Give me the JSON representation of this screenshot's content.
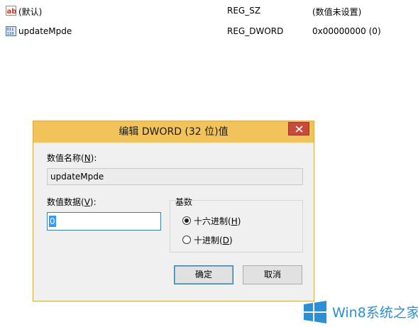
{
  "registry": {
    "rows": [
      {
        "icon": "string-value-icon",
        "name": "(默认)",
        "type": "REG_SZ",
        "data": "(数值未设置)"
      },
      {
        "icon": "dword-value-icon",
        "name": "updateMpde",
        "type": "REG_DWORD",
        "data": "0x00000000 (0)"
      }
    ]
  },
  "dialog": {
    "title": "编辑 DWORD (32 位)值",
    "name_label_pre": "数值名称(",
    "name_label_key": "N",
    "name_label_post": "):",
    "name_value": "updateMpde",
    "data_label_pre": "数值数据(",
    "data_label_key": "V",
    "data_label_post": "):",
    "data_value": "0",
    "base_label": "基数",
    "radio_hex_pre": "十六进制(",
    "radio_hex_key": "H",
    "radio_hex_post": ")",
    "radio_dec_pre": "十进制(",
    "radio_dec_key": "D",
    "radio_dec_post": ")",
    "selected_base": "hex",
    "ok_label": "确定",
    "cancel_label": "取消"
  },
  "watermark": {
    "text": "Win8系统之家"
  },
  "colors": {
    "titlebar": "#f2c35b",
    "close": "#c74b3a",
    "focus": "#3c7fb1",
    "watermark": "#2a8fd4"
  }
}
